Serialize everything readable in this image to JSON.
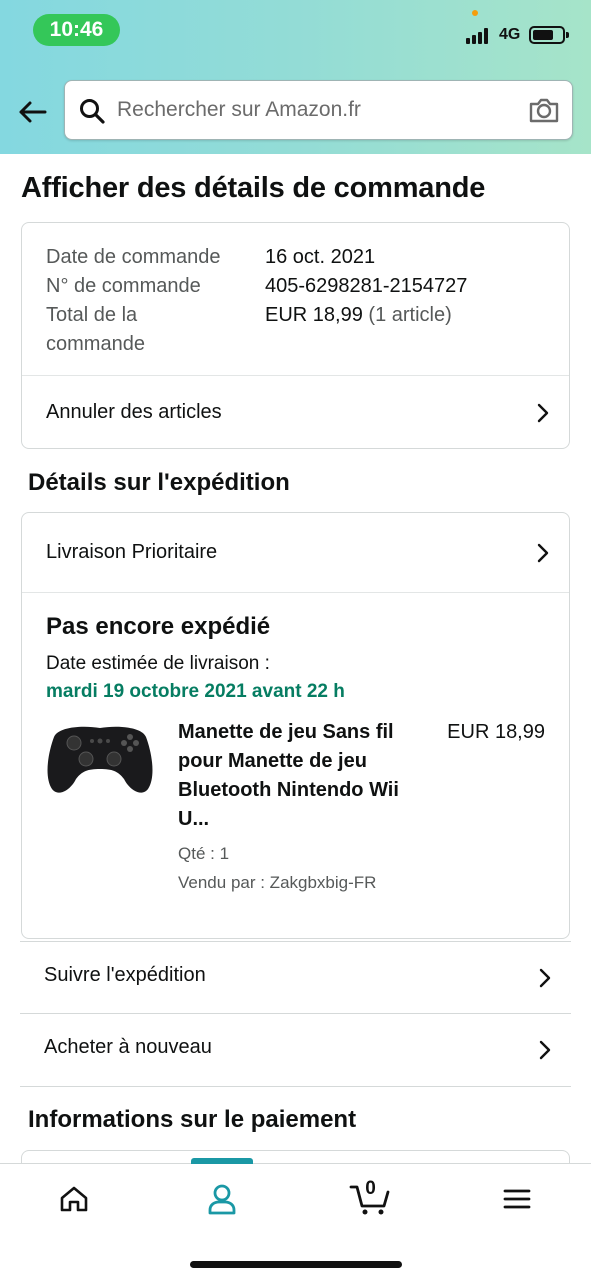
{
  "status_bar": {
    "time": "10:46",
    "network": "4G"
  },
  "search": {
    "placeholder": "Rechercher sur Amazon.fr"
  },
  "page": {
    "title": "Afficher des détails de commande"
  },
  "order_summary": {
    "rows": [
      {
        "label": "Date de commande",
        "value": "16 oct. 2021",
        "extra": ""
      },
      {
        "label": "N° de commande",
        "value": "405-6298281-2154727",
        "extra": ""
      },
      {
        "label": "Total de la commande",
        "value": "EUR 18,99",
        "extra": "(1 article)"
      }
    ],
    "cancel_label": "Annuler des articles"
  },
  "shipping": {
    "section_title": "Détails sur l'expédition",
    "method_label": "Livraison Prioritaire",
    "status": "Pas encore expédié",
    "eta_label": "Date estimée de livraison :",
    "eta_date": "mardi 19 octobre 2021 avant 22 h",
    "product": {
      "title": "Manette de jeu Sans fil pour Manette de jeu Bluetooth Nintendo Wii U...",
      "price": "EUR 18,99",
      "qty": "Qté : 1",
      "seller": "Vendu par : Zakgbxbig-FR"
    }
  },
  "actions": {
    "track": "Suivre l'expédition",
    "buy_again": "Acheter à nouveau"
  },
  "payment": {
    "section_title": "Informations sur le paiement"
  },
  "bottom_nav": {
    "cart_count": "0",
    "active_item": "account",
    "accent_color": "#1a98a5"
  }
}
